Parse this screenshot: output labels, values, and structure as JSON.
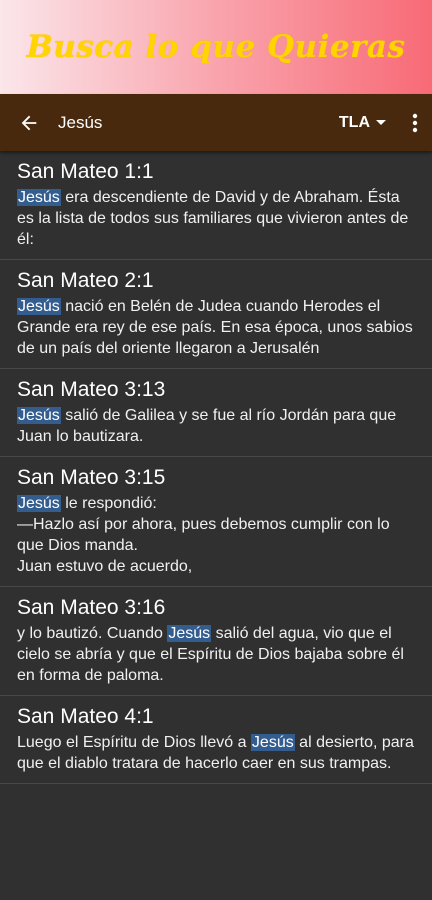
{
  "banner": {
    "title": "Busca lo que Quieras"
  },
  "toolbar": {
    "search_term": "Jesús",
    "version": "TLA"
  },
  "results": [
    {
      "reference": "San Mateo 1:1",
      "segments": [
        "",
        "Jesús",
        " era descendiente de David y de Abraham. Ésta es la lista de todos sus familiares que vivieron antes de él:"
      ]
    },
    {
      "reference": "San Mateo 2:1",
      "segments": [
        "",
        "Jesús",
        " nació en Belén de Judea cuando Herodes el Grande era rey de ese país. En esa época, unos sabios de un país del oriente llegaron a Jerusalén"
      ]
    },
    {
      "reference": "San Mateo 3:13",
      "segments": [
        "",
        "Jesús",
        " salió de Galilea y se fue al río Jordán para que Juan lo bautizara."
      ]
    },
    {
      "reference": "San Mateo 3:15",
      "segments": [
        "",
        "Jesús",
        " le respondió:\n—Hazlo así por ahora, pues debemos cumplir con lo que Dios manda.\nJuan estuvo de acuerdo,"
      ]
    },
    {
      "reference": "San Mateo 3:16",
      "segments": [
        "y lo bautizó. Cuando ",
        "Jesús",
        " salió del agua, vio que el cielo se abría y que el Espíritu de Dios bajaba sobre él en forma de paloma."
      ]
    },
    {
      "reference": "San Mateo 4:1",
      "segments": [
        "Luego el Espíritu de Dios llevó a ",
        "Jesús",
        " al desierto, para que el diablo tratara de hacerlo caer en sus trampas."
      ]
    }
  ],
  "icons": {
    "back": "arrow-back-icon",
    "more": "more-vert-icon",
    "dropdown": "caret-down-icon"
  },
  "colors": {
    "toolbar": "#49290d",
    "background": "#303030",
    "highlight": "#335c8f",
    "banner_text": "#ffd400"
  }
}
